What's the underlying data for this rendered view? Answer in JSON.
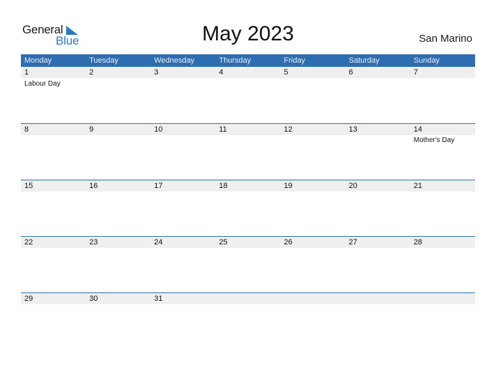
{
  "logo": {
    "word1": "General",
    "word2": "Blue",
    "accent": "#2b7bc4"
  },
  "title": "May 2023",
  "country": "San Marino",
  "header_color": "#2e6db0",
  "weekdays": [
    "Monday",
    "Tuesday",
    "Wednesday",
    "Thursday",
    "Friday",
    "Saturday",
    "Sunday"
  ],
  "weeks": [
    {
      "dates": [
        "1",
        "2",
        "3",
        "4",
        "5",
        "6",
        "7"
      ],
      "events": [
        "Labour Day",
        "",
        "",
        "",
        "",
        "",
        ""
      ]
    },
    {
      "dates": [
        "8",
        "9",
        "10",
        "11",
        "12",
        "13",
        "14"
      ],
      "events": [
        "",
        "",
        "",
        "",
        "",
        "",
        "Mother's Day"
      ]
    },
    {
      "dates": [
        "15",
        "16",
        "17",
        "18",
        "19",
        "20",
        "21"
      ],
      "events": [
        "",
        "",
        "",
        "",
        "",
        "",
        ""
      ]
    },
    {
      "dates": [
        "22",
        "23",
        "24",
        "25",
        "26",
        "27",
        "28"
      ],
      "events": [
        "",
        "",
        "",
        "",
        "",
        "",
        ""
      ]
    },
    {
      "dates": [
        "29",
        "30",
        "31",
        "",
        "",
        "",
        ""
      ],
      "events": [
        "",
        "",
        "",
        "",
        "",
        "",
        ""
      ]
    }
  ]
}
